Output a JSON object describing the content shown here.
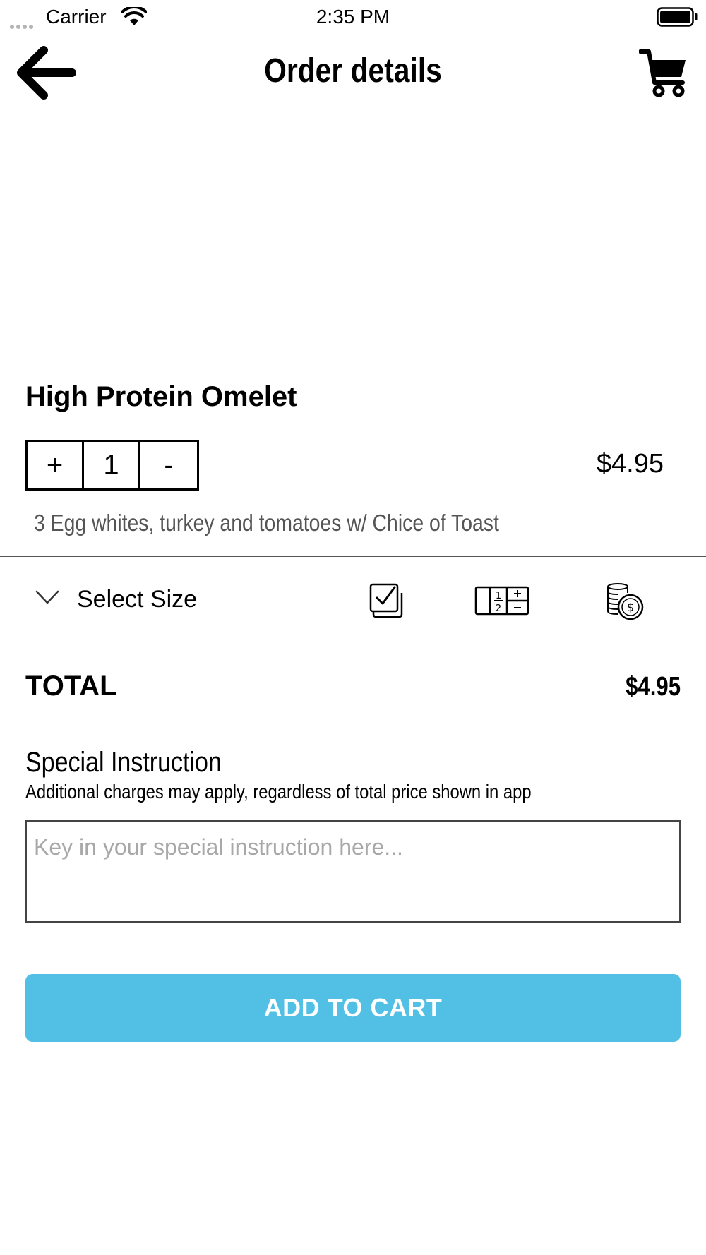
{
  "status_bar": {
    "carrier": "Carrier",
    "time": "2:35 PM"
  },
  "nav": {
    "title": "Order details",
    "back_icon": "arrow-left-icon",
    "cart_icon": "shopping-cart-icon"
  },
  "product": {
    "name": "High Protein Omelet",
    "quantity": "1",
    "increment_label": "+",
    "decrement_label": "-",
    "price": "$4.95",
    "description": "3 Egg whites, turkey and tomatoes w/ Chice of Toast"
  },
  "size_selector": {
    "label": "Select Size",
    "icons": [
      "chevron-down-icon",
      "check-stack-icon",
      "fraction-icon",
      "coins-icon"
    ]
  },
  "total": {
    "label": "TOTAL",
    "value": "$4.95"
  },
  "special_instruction": {
    "title": "Special Instruction",
    "note": "Additional charges may apply, regardless of total price shown in app",
    "placeholder": "Key in your special instruction here..."
  },
  "actions": {
    "add_to_cart_label": "ADD TO CART"
  },
  "colors": {
    "accent": "#52c0e4",
    "description_text": "#555555",
    "placeholder_text": "#a8a8a8"
  }
}
